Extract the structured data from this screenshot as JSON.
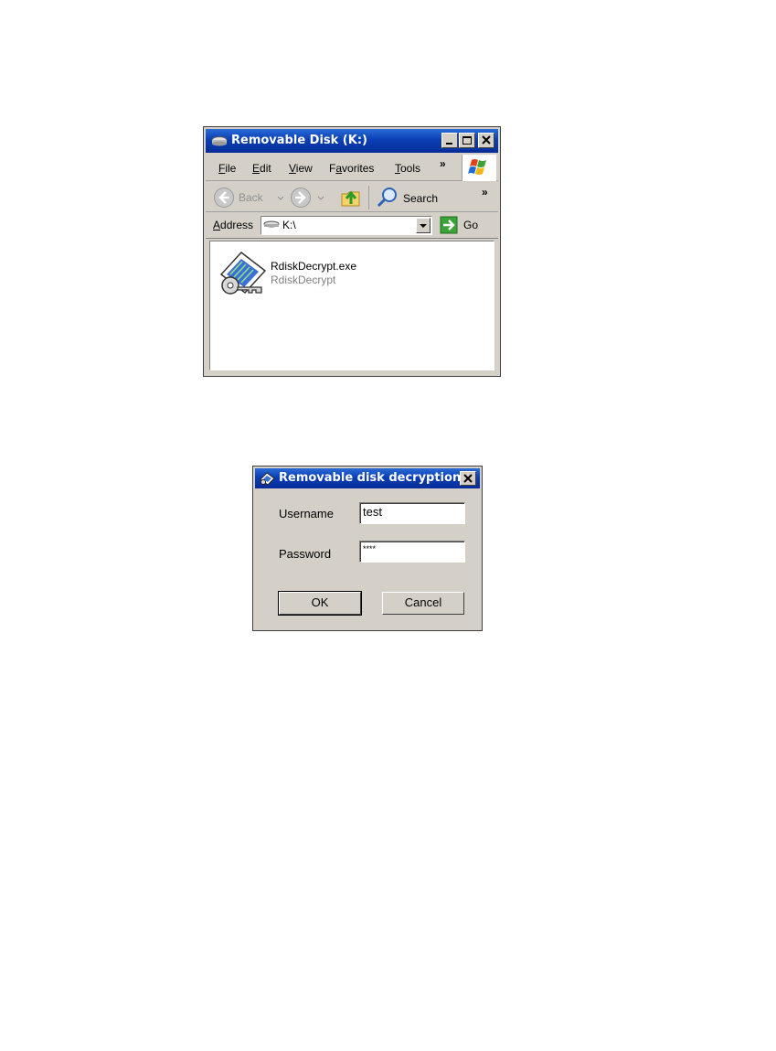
{
  "explorer": {
    "title": "Removable Disk (K:)",
    "menu": [
      "File",
      "Edit",
      "View",
      "Favorites",
      "Tools"
    ],
    "menu_underline": [
      "F",
      "E",
      "V",
      "a",
      "T"
    ],
    "overflow": "»",
    "toolbar": {
      "back": "Back",
      "search": "Search"
    },
    "address": {
      "label": "Address",
      "value": "K:\\",
      "go": "Go"
    },
    "file": {
      "name": "RdiskDecrypt.exe",
      "description": "RdiskDecrypt"
    }
  },
  "dialog": {
    "title": "Removable disk decryption",
    "username_label": "Username",
    "username_value": "test",
    "password_label": "Password",
    "password_value": "****",
    "ok": "OK",
    "cancel": "Cancel"
  }
}
